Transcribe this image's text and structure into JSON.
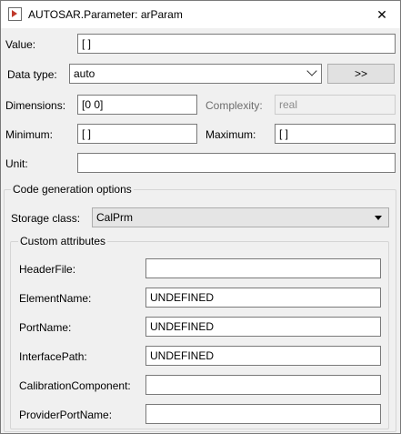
{
  "window": {
    "title": "AUTOSAR.Parameter: arParam",
    "close_glyph": "✕"
  },
  "form": {
    "value_label": "Value:",
    "value": "[ ]",
    "datatype_label": "Data type:",
    "datatype_value": "auto",
    "datatype_button": ">>",
    "dimensions_label": "Dimensions:",
    "dimensions_value": "[0 0]",
    "complexity_label": "Complexity:",
    "complexity_value": "real",
    "minimum_label": "Minimum:",
    "minimum_value": "[ ]",
    "maximum_label": "Maximum:",
    "maximum_value": "[ ]",
    "unit_label": "Unit:",
    "unit_value": ""
  },
  "codegen": {
    "group_title": "Code generation options",
    "storage_class_label": "Storage class:",
    "storage_class_value": "CalPrm",
    "custom": {
      "group_title": "Custom attributes",
      "fields": [
        {
          "label": "HeaderFile:",
          "value": ""
        },
        {
          "label": "ElementName:",
          "value": "UNDEFINED"
        },
        {
          "label": "PortName:",
          "value": "UNDEFINED"
        },
        {
          "label": "InterfacePath:",
          "value": "UNDEFINED"
        },
        {
          "label": "CalibrationComponent:",
          "value": ""
        },
        {
          "label": "ProviderPortName:",
          "value": ""
        }
      ]
    }
  },
  "icons": {
    "app": "simulink-app-icon",
    "close": "close-icon",
    "datatype_dropdown": "chevron-down-icon",
    "storage_dropdown": "triangle-down-icon"
  }
}
